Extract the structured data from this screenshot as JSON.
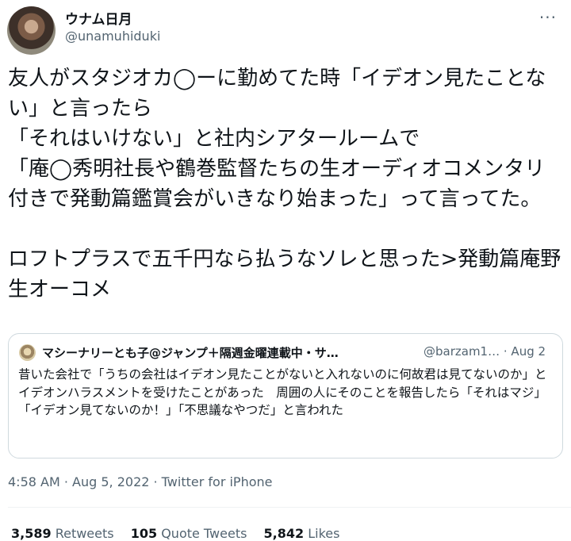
{
  "author": {
    "display_name": "ウナム日月",
    "handle": "@unamuhiduki"
  },
  "icons": {
    "more": "more-icon",
    "avatar": "avatar"
  },
  "tweet": {
    "text": "友人がスタジオカ◯ーに勤めてた時「イデオン見たことない」と言ったら\n「それはいけない」と社内シアタールームで\n「庵◯秀明社長や鶴巻監督たちの生オーディオコメンタリ付きで発動篇鑑賞会がいきなり始まった」って言ってた。\n\nロフトプラスで五千円なら払うなソレと思った>発動篇庵野生オーコメ"
  },
  "quoted_tweet": {
    "display_name": "マシーナリーとも子@ジャンプ＋隔週金曜連載中・サ…",
    "handle": "@barzam1…",
    "date": "· Aug 2",
    "text": "昔いた会社で「うちの会社はイデオン見たことがないと入れないのに何故君は見てないのか」とイデオンハラスメントを受けたことがあった　周囲の人にそのことを報告したら「それはマジ」「イデオン見てないのか！」「不思議なやつだ」と言われた"
  },
  "meta": {
    "timestamp": "4:58 AM · Aug 5, 2022 · Twitter for iPhone"
  },
  "stats": {
    "retweets_count": "3,589",
    "retweets_label": "Retweets",
    "quotes_count": "105",
    "quotes_label": "Quote Tweets",
    "likes_count": "5,842",
    "likes_label": "Likes"
  }
}
